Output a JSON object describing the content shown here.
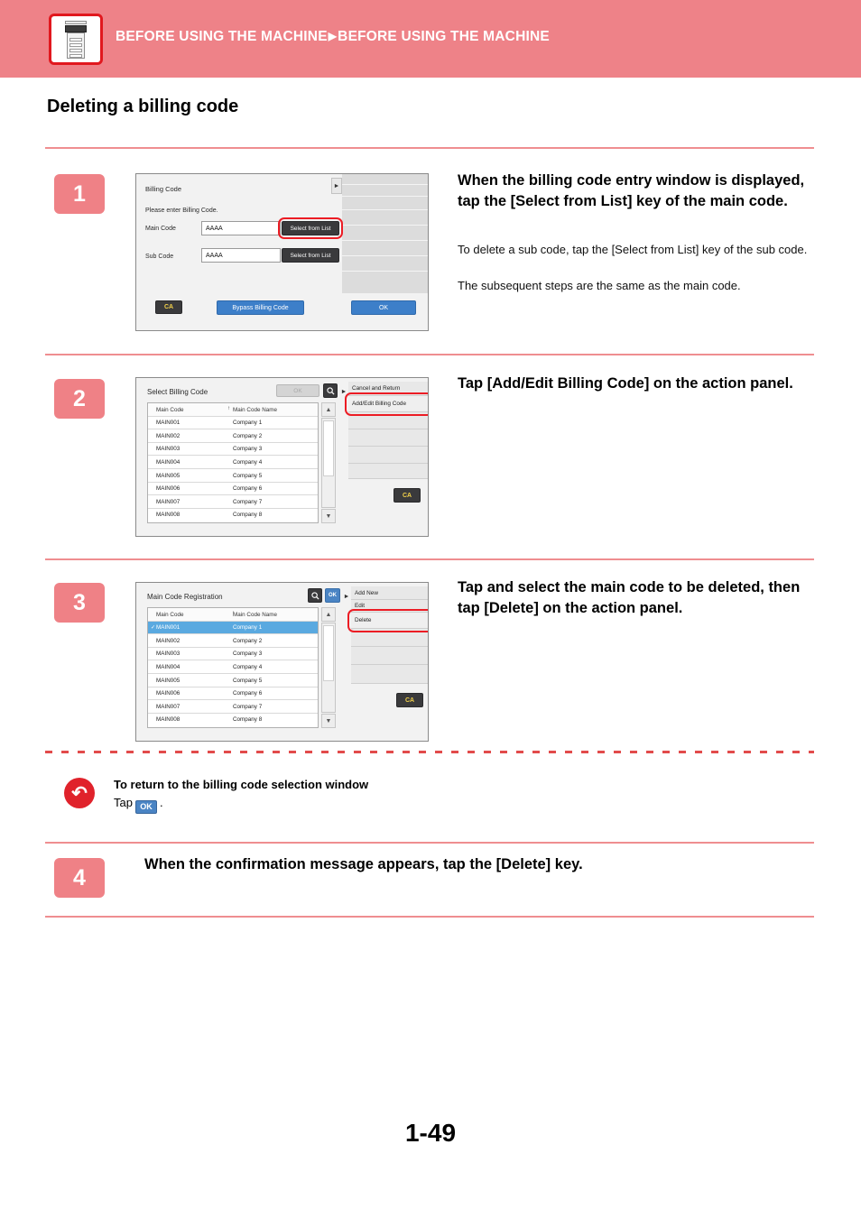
{
  "header": {
    "icon": "multifunction-printer-icon",
    "breadcrumb_1": "BEFORE USING THE MACHINE",
    "separator": "▶",
    "breadcrumb_2": "BEFORE USING THE MACHINE",
    "band_color": "#ee8288"
  },
  "page_title": "Deleting a billing code",
  "page_number": "1-49",
  "steps": [
    {
      "number": "1",
      "heading": "When the billing code entry window is displayed, tap the [Select from List] key of the main code.",
      "body_line_1": "To delete a sub code, tap the [Select from List] key of the sub code.",
      "body_line_2": "The subsequent steps are the same as the main code.",
      "screen": {
        "title": "Billing Code",
        "prompt": "Please enter Billing Code.",
        "main_code_label": "Main Code",
        "main_code_value": "AAAA",
        "main_code_button": "Select from List",
        "sub_code_label": "Sub Code",
        "sub_code_value": "AAAA",
        "sub_code_button": "Select from List",
        "ca_key": "CA",
        "bypass_key": "Bypass Billing Code",
        "ok_key": "OK"
      }
    },
    {
      "number": "2",
      "heading": "Tap [Add/Edit Billing Code] on the action panel.",
      "screen": {
        "title": "Select Billing Code",
        "ok_key": "OK",
        "search_icon": "search-icon",
        "col_code": "Main Code",
        "col_name": "Main Code Name",
        "sort_icon": "↑",
        "rows": [
          {
            "code": "MAIN001",
            "name": "Company 1"
          },
          {
            "code": "MAIN002",
            "name": "Company 2"
          },
          {
            "code": "MAIN003",
            "name": "Company 3"
          },
          {
            "code": "MAIN004",
            "name": "Company 4"
          },
          {
            "code": "MAIN005",
            "name": "Company 5"
          },
          {
            "code": "MAIN006",
            "name": "Company 6"
          },
          {
            "code": "MAIN007",
            "name": "Company 7"
          },
          {
            "code": "MAIN008",
            "name": "Company 8"
          }
        ],
        "action_panel": [
          "Cancel and Return",
          "Add/Edit Billing Code"
        ],
        "highlighted_action": "Add/Edit Billing Code",
        "ca_key": "CA"
      }
    },
    {
      "number": "3",
      "heading": "Tap and select the main code to be deleted, then tap [Delete] on the action panel.",
      "screen": {
        "title": "Main Code Registration",
        "search_icon": "search-icon",
        "ok_key": "OK",
        "col_code": "Main Code",
        "col_name": "Main Code Name",
        "sort_icon": "↑",
        "rows": [
          {
            "code": "MAIN001",
            "name": "Company 1",
            "selected": true
          },
          {
            "code": "MAIN002",
            "name": "Company 2"
          },
          {
            "code": "MAIN003",
            "name": "Company 3"
          },
          {
            "code": "MAIN004",
            "name": "Company 4"
          },
          {
            "code": "MAIN005",
            "name": "Company 5"
          },
          {
            "code": "MAIN006",
            "name": "Company 6"
          },
          {
            "code": "MAIN007",
            "name": "Company 7"
          },
          {
            "code": "MAIN008",
            "name": "Company 8"
          }
        ],
        "action_panel": [
          "Add New",
          "Edit",
          "Delete"
        ],
        "highlighted_action": "Delete",
        "ca_key": "CA"
      }
    },
    {
      "number": "4",
      "heading": "When the confirmation message appears, tap the [Delete] key."
    }
  ],
  "note": {
    "icon": "return-arrow-icon",
    "title": "To return to the billing code selection window",
    "line_prefix": "Tap",
    "key_label": "OK",
    "line_suffix": "."
  },
  "colors": {
    "accent": "#ee8288",
    "rule": "#ef8e90",
    "highlight": "#ec1c24",
    "note_circle": "#e0222b",
    "key_blue": "#3d7fc9",
    "selected_row": "#5aa9e0"
  }
}
